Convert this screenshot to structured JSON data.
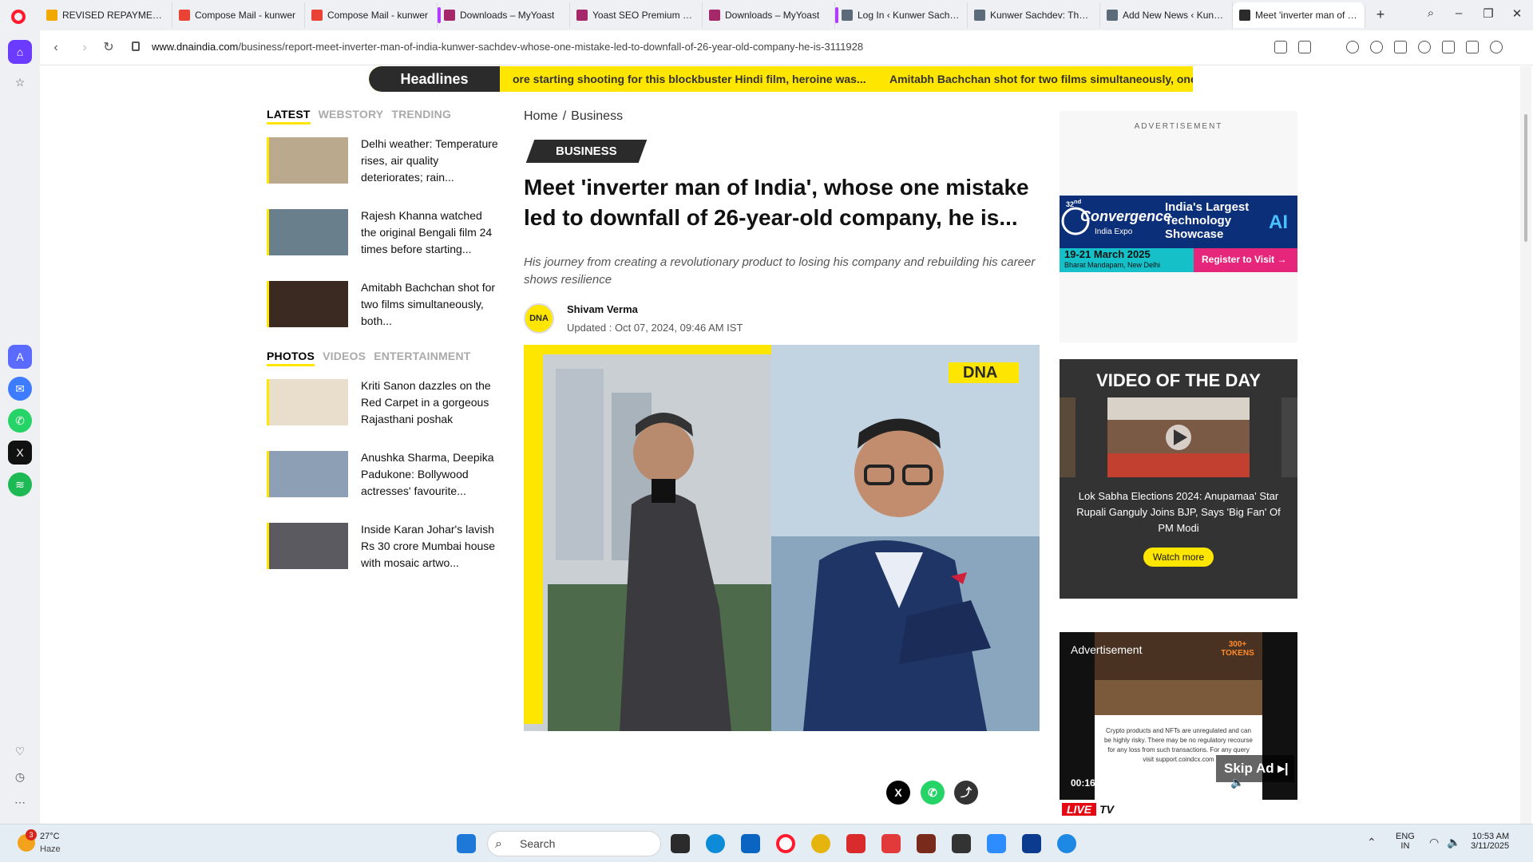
{
  "browser": {
    "tabs": [
      {
        "label": "REVISED REPAYMENT PL",
        "color": "#f2a900"
      },
      {
        "label": "Compose Mail - kunwer",
        "color": "#ea4335"
      },
      {
        "label": "Compose Mail - kunwer",
        "color": "#ea4335"
      },
      {
        "label": "Downloads – MyYoast",
        "color": "#a4286a"
      },
      {
        "label": "Yoast SEO Premium char",
        "color": "#a4286a"
      },
      {
        "label": "Downloads – MyYoast",
        "color": "#a4286a"
      },
      {
        "label": "Log In ‹ Kunwer Sachdev",
        "color": "#5b6b7a"
      },
      {
        "label": "Kunwer Sachdev: The Inv",
        "color": "#5b6b7a"
      },
      {
        "label": "Add New News ‹ Kunwe",
        "color": "#5b6b7a"
      },
      {
        "label": "Meet 'inverter man of Indi",
        "color": "#2b2b2b"
      }
    ],
    "url_domain": "www.dnaindia.com",
    "url_path": "/business/report-meet-inverter-man-of-india-kunwer-sachdev-whose-one-mistake-led-to-downfall-of-26-year-old-company-he-is-3111928"
  },
  "ticker": {
    "label": "Headlines",
    "items": [
      "ore starting shooting for this blockbuster Hindi film, heroine was...",
      "Amitabh Bachchan shot for two films simultaneously, one"
    ]
  },
  "latest": {
    "tabs": [
      "LATEST",
      "WEBSTORY",
      "TRENDING"
    ],
    "items": [
      {
        "title": "Delhi weather: Temperature rises, air quality deteriorates; rain...",
        "color": "#bba98e"
      },
      {
        "title": "Rajesh Khanna watched the original Bengali film 24 times before starting...",
        "color": "#6a7f8c"
      },
      {
        "title": "Amitabh Bachchan shot for two films simultaneously, both...",
        "color": "#3a2a22"
      }
    ]
  },
  "photos": {
    "tabs": [
      "PHOTOS",
      "VIDEOS",
      "ENTERTAINMENT"
    ],
    "items": [
      {
        "title": "Kriti Sanon dazzles on the Red Carpet in a gorgeous Rajasthani poshak",
        "color": "#e9ddcc"
      },
      {
        "title": "Anushka Sharma, Deepika Padukone: Bollywood actresses' favourite...",
        "color": "#8c9fb5"
      },
      {
        "title": "Inside Karan Johar's lavish Rs 30 crore Mumbai house with mosaic artwo...",
        "color": "#5a5a60"
      }
    ]
  },
  "article": {
    "breadcrumb": [
      "Home",
      "Business"
    ],
    "category": "BUSINESS",
    "headline": "Meet 'inverter man of India', whose one mistake led to downfall of 26-year-old company, he is...",
    "summary": "His journey from creating a revolutionary product to losing his company and rebuilding his career shows resilience",
    "author": "Shivam Verma",
    "avatar_text": "DNA",
    "updated": "Updated : Oct 07, 2024, 09:46 AM IST",
    "image_logo": "DNA"
  },
  "ad": {
    "label": "ADVERTISEMENT",
    "banner": {
      "brand_num": "32",
      "brand_sup": "nd",
      "brand": "Convergence",
      "brand_sub": "India Expo",
      "tagline": "India's Largest Technology Showcase",
      "ai": "AI",
      "dates": "19-21 March 2025",
      "venue": "Bharat Mandapam, New Delhi",
      "cta": "Register to Visit"
    }
  },
  "video_of_day": {
    "title": "VIDEO OF THE DAY",
    "caption": "Lok Sabha Elections 2024: Anupamaa' Star Rupali Ganguly Joins BJP, Says 'Big Fan' Of PM Modi",
    "button": "Watch more"
  },
  "video_ad": {
    "label": "Advertisement",
    "promo": "300+ TOKENS",
    "disclaimer": "Crypto products and NFTs are unregulated and can be highly risky. There may be no regulatory recourse for any loss from such transactions. For any query visit support.coindcx.com",
    "time": "00:16 / 00:20",
    "skip": "Skip Ad"
  },
  "live_tv": {
    "badge": "LIVE",
    "suffix": "TV"
  },
  "taskbar": {
    "weather_temp": "27°C",
    "weather_desc": "Haze",
    "weather_badge": "3",
    "search_placeholder": "Search",
    "lang": "ENG",
    "region": "IN",
    "time": "10:53 AM",
    "date": "3/11/2025"
  }
}
